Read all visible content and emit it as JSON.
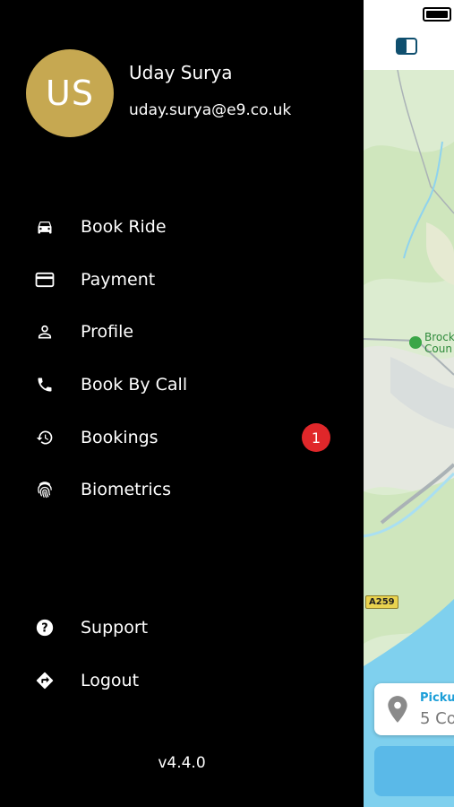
{
  "user": {
    "initials": "US",
    "name": "Uday Surya",
    "email": "uday.surya@e9.co.uk",
    "avatar_color": "#c6a851"
  },
  "menu": {
    "items": [
      {
        "label": "Book Ride",
        "icon": "car-icon"
      },
      {
        "label": "Payment",
        "icon": "credit-card-icon"
      },
      {
        "label": "Profile",
        "icon": "person-icon"
      },
      {
        "label": "Book By Call",
        "icon": "phone-icon"
      },
      {
        "label": "Bookings",
        "icon": "history-icon",
        "badge": "1"
      },
      {
        "label": "Biometrics",
        "icon": "fingerprint-icon"
      }
    ],
    "footer_items": [
      {
        "label": "Support",
        "icon": "help-icon"
      },
      {
        "label": "Logout",
        "icon": "directions-icon"
      }
    ]
  },
  "version": "v4.4.0",
  "map": {
    "poi_label_line1": "Brock",
    "poi_label_line2": "Coun",
    "road_label": "A259",
    "pickup_title": "Pickup",
    "pickup_address": "5 Co"
  },
  "colors": {
    "drawer_bg": "#000000",
    "badge": "#e0272a",
    "accent": "#1b9ed8",
    "sea": "#7fd0ee"
  }
}
